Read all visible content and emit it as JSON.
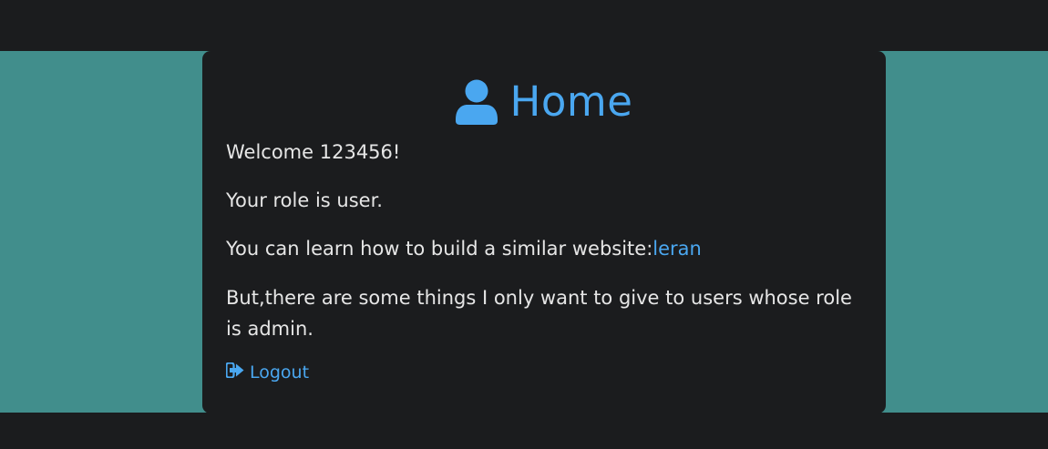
{
  "header": {
    "title": "Home",
    "title_icon": "user-icon"
  },
  "content": {
    "welcome": "Welcome 123456!",
    "role": "Your role is user.",
    "learn_prefix": "You can learn how to build a similar website:",
    "learn_link": "leran",
    "admin_note": "But,there are some things I only want to give to users whose role is admin."
  },
  "actions": {
    "logout_label": "Logout",
    "logout_icon": "logout-icon"
  },
  "colors": {
    "background": "#1b1c1e",
    "band": "#418e8c",
    "accent": "#4aa7f0",
    "text": "#e6e6e6"
  }
}
